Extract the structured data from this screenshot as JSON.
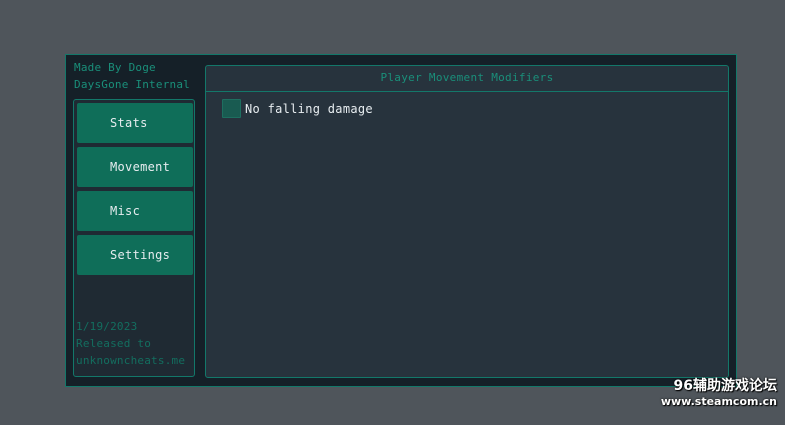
{
  "window": {
    "title_line1": "Made By Doge",
    "title_line2": "DaysGone Internal"
  },
  "sidebar": {
    "items": [
      {
        "label": "Stats"
      },
      {
        "label": "Movement"
      },
      {
        "label": "Misc"
      },
      {
        "label": "Settings"
      }
    ],
    "footer": {
      "date": "1/19/2023",
      "released_to": "Released to",
      "site": "unknowncheats.me"
    }
  },
  "panel": {
    "title": "Player Movement Modifiers",
    "options": [
      {
        "label": "No falling damage",
        "checked": false
      }
    ]
  },
  "watermark": {
    "line1": "96辅助游戏论坛",
    "line2": "www.steamcom.cn"
  },
  "colors": {
    "background": "#4f555b",
    "window_bg": "#152028",
    "accent": "#13786a",
    "button": "#0f6e59",
    "panel_bg": "#27333d",
    "checkbox": "#195b51"
  }
}
